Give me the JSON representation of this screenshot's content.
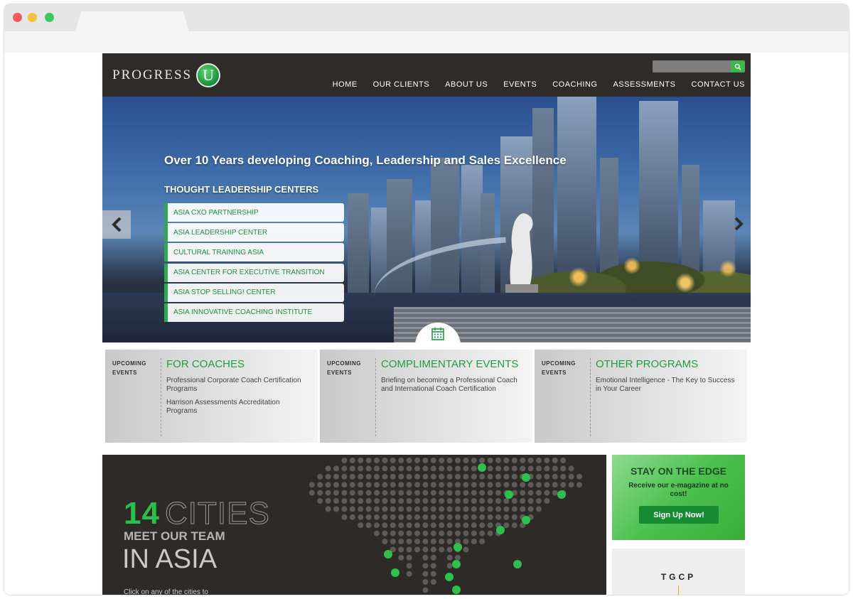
{
  "brand": {
    "name": "PROGRESS",
    "mark": "U"
  },
  "search": {
    "placeholder": ""
  },
  "nav": {
    "items": [
      "HOME",
      "OUR CLIENTS",
      "ABOUT US",
      "EVENTS",
      "COACHING",
      "ASSESSMENTS",
      "CONTACT US"
    ]
  },
  "hero": {
    "title": "Over 10 Years developing Coaching, Leadership and Sales Excellence",
    "subtitle": "THOUGHT LEADERSHIP CENTERS",
    "centers": [
      "ASIA CXO PARTNERSHIP",
      "ASIA LEADERSHIP CENTER",
      "CULTURAL TRAINING ASIA",
      "ASIA CENTER FOR EXECUTIVE TRANSITION",
      "ASIA STOP SELLING! CENTER",
      "ASIA INNOVATIVE COACHING INSTITUTE"
    ]
  },
  "events": [
    {
      "label_top": "UPCOMING",
      "label_bottom": "EVENTS",
      "title": "FOR COACHES",
      "items": [
        "Professional Corporate Coach Certification Programs",
        "Harrison Assessments Accreditation Programs"
      ]
    },
    {
      "label_top": "UPCOMING",
      "label_bottom": "EVENTS",
      "title": "COMPLIMENTARY EVENTS",
      "items": [
        "Briefing on becoming a Professional Coach and International Coach Certification"
      ]
    },
    {
      "label_top": "UPCOMING",
      "label_bottom": "EVENTS",
      "title": "OTHER PROGRAMS",
      "items": [
        "Emotional Intelligence - The Key to Success in Your Career"
      ]
    }
  ],
  "cities": {
    "count": "14",
    "word": "CITIES",
    "meet": "MEET OUR TEAM",
    "region": "IN ASIA",
    "hint": "Click on any of the cities to"
  },
  "newsletter": {
    "title": "STAY ON THE EDGE",
    "subtitle": "Receive our e-magazine at no cost!",
    "button": "Sign Up Now!"
  },
  "partner": {
    "name": "TGCP"
  },
  "colors": {
    "brand_green": "#2fa84f",
    "header_dark": "#2f2b28"
  }
}
